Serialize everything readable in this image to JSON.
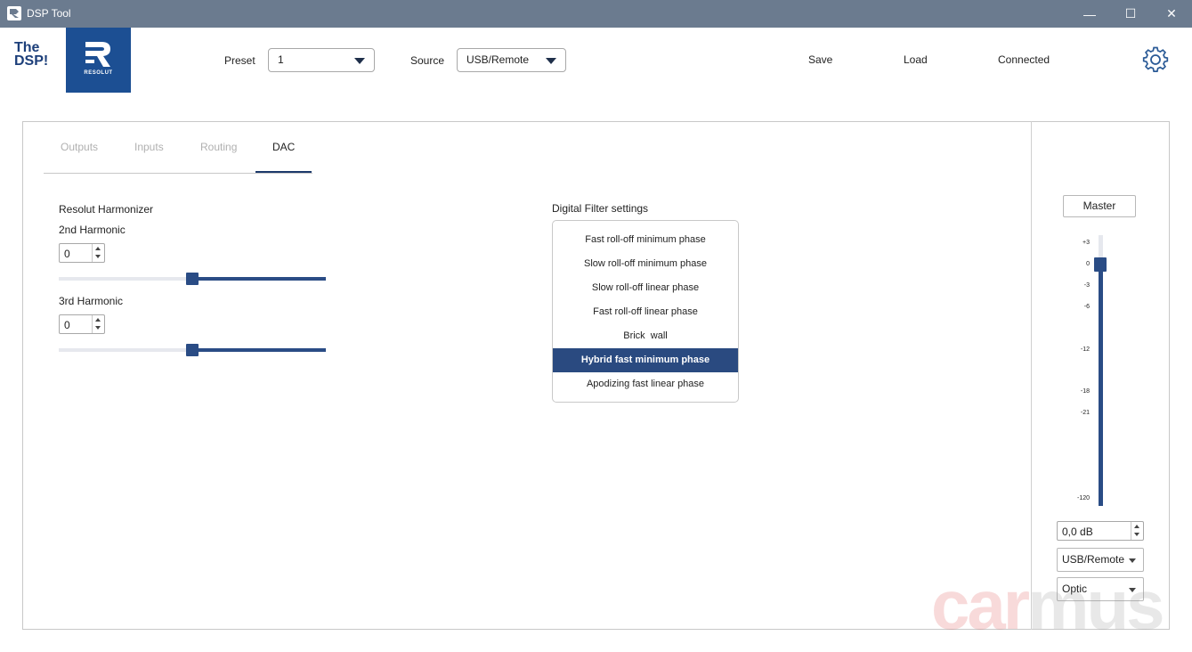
{
  "window": {
    "title": "DSP Tool",
    "minimize_glyph": "—",
    "maximize_glyph": "☐",
    "close_glyph": "✕"
  },
  "header": {
    "logo_line1": "The",
    "logo_line2": "DSP!",
    "brand_sub": "RESOLUT",
    "preset_label": "Preset",
    "preset_value": "1",
    "source_label": "Source",
    "source_value": "USB/Remote",
    "save_label": "Save",
    "load_label": "Load",
    "status": "Connected"
  },
  "tabs": [
    {
      "label": "Outputs",
      "active": false
    },
    {
      "label": "Inputs",
      "active": false
    },
    {
      "label": "Routing",
      "active": false
    },
    {
      "label": "DAC",
      "active": true
    }
  ],
  "harmonizer": {
    "title": "Resolut Harmonizer",
    "second": {
      "label": "2nd Harmonic",
      "value": "0",
      "slider_fraction": 0.5
    },
    "third": {
      "label": "3rd Harmonic",
      "value": "0",
      "slider_fraction": 0.5
    }
  },
  "filter": {
    "title": "Digital Filter settings",
    "options": [
      "Fast roll-off minimum phase",
      "Slow roll-off minimum phase",
      "Slow roll-off linear phase",
      "Fast roll-off linear phase",
      "Brick  wall",
      "Hybrid fast minimum phase",
      "Apodizing fast linear phase"
    ],
    "selected_index": 5
  },
  "master": {
    "label": "Master",
    "scale": [
      "+3",
      "0",
      "-3",
      "-6",
      "-12",
      "-18",
      "-21",
      "-120"
    ],
    "level_db": "0,0 dB",
    "source_value": "USB/Remote",
    "input_value": "Optic"
  },
  "colors": {
    "accent": "#2a4c85",
    "titlebar": "#6b7b8f",
    "brand": "#1c4f93"
  },
  "watermark": {
    "part1": "car",
    "part2": "mus"
  }
}
